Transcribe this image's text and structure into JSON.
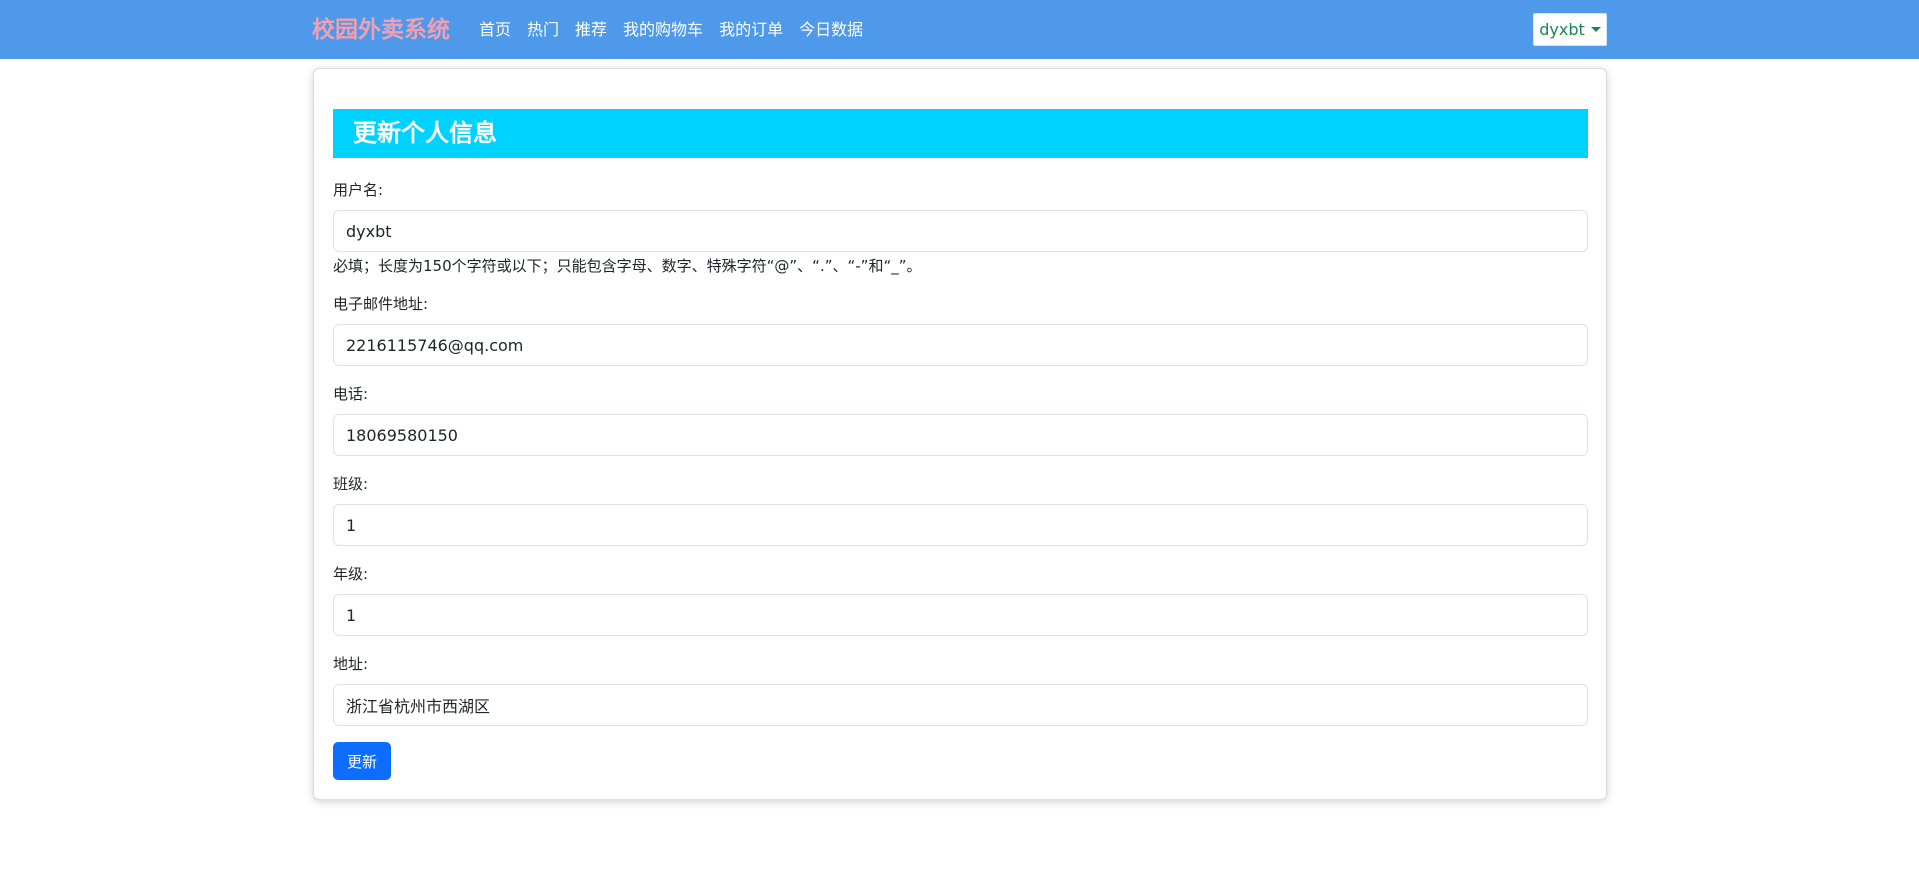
{
  "navbar": {
    "brand": "校园外卖系统",
    "links": [
      "首页",
      "热门",
      "推荐",
      "我的购物车",
      "我的订单",
      "今日数据"
    ],
    "user": "dyxbt"
  },
  "form": {
    "title": "更新个人信息",
    "username": {
      "label": "用户名:",
      "value": "dyxbt",
      "help": "必填；长度为150个字符或以下；只能包含字母、数字、特殊字符“@”、“.”、“-”和“_”。"
    },
    "email": {
      "label": "电子邮件地址:",
      "value": "2216115746@qq.com"
    },
    "phone": {
      "label": "电话:",
      "value": "18069580150"
    },
    "class": {
      "label": "班级:",
      "value": "1"
    },
    "grade": {
      "label": "年级:",
      "value": "1"
    },
    "address": {
      "label": "地址:",
      "value": "浙江省杭州市西湖区"
    },
    "submit_label": "更新"
  },
  "colors": {
    "navbar_bg": "#4e99e9",
    "brand": "#f19fb3",
    "title_bg": "#00d2ff",
    "button_bg": "#0d6efd",
    "dropdown_text": "#198754"
  },
  "icons": {
    "dropdown": "caret-down-icon"
  }
}
